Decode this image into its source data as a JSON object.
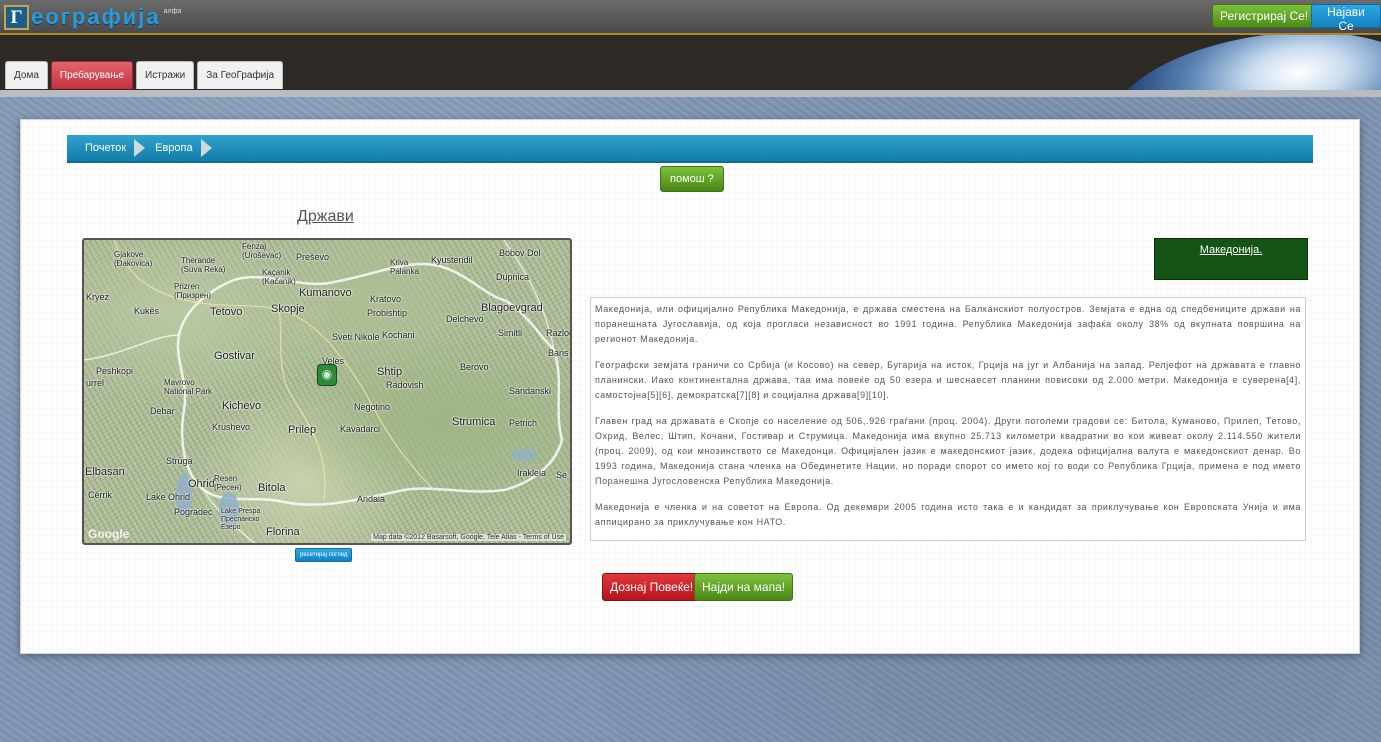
{
  "header": {
    "logo_letter": "Г",
    "logo_text": "еографија",
    "logo_tag": "алфа",
    "register_label": "Регистрирај Се!",
    "login_label": "Најави Се"
  },
  "nav": {
    "tabs": [
      {
        "label": "Дома"
      },
      {
        "label": "Пребарување"
      },
      {
        "label": "Истражи"
      },
      {
        "label": "За ГеоГрафија"
      }
    ]
  },
  "breadcrumb": {
    "items": [
      {
        "label": "Почеток"
      },
      {
        "label": "Европа"
      }
    ]
  },
  "help_label": "помош ?",
  "section_title": "Држави",
  "map": {
    "cities": [
      {
        "name": "Gjakove\n(Đakovica)"
      },
      {
        "name": "Therande\n(Suva Reka)"
      },
      {
        "name": "Fenzaj\n(Uroševac)"
      },
      {
        "name": "Preševo"
      },
      {
        "name": "Kriva\nPalanka"
      },
      {
        "name": "Kyustendil"
      },
      {
        "name": "Bobov Dol"
      },
      {
        "name": "Kaçanik\n(Kačanik)"
      },
      {
        "name": "Prizren\n(Призрен)"
      },
      {
        "name": "Kumanovo"
      },
      {
        "name": "Dupnica"
      },
      {
        "name": "Kryez"
      },
      {
        "name": "Kukës"
      },
      {
        "name": "Tetovo"
      },
      {
        "name": "Skopje"
      },
      {
        "name": "Kratovo"
      },
      {
        "name": "Probishtip"
      },
      {
        "name": "Blagoevgrad"
      },
      {
        "name": "Delchevo"
      },
      {
        "name": "Simitli"
      },
      {
        "name": "Razlog"
      },
      {
        "name": "Sveti Nikole"
      },
      {
        "name": "Kochani"
      },
      {
        "name": "Gostivar"
      },
      {
        "name": "Veles"
      },
      {
        "name": "Bans"
      },
      {
        "name": "Peshkopi"
      },
      {
        "name": "Shtip"
      },
      {
        "name": "Berovo"
      },
      {
        "name": "Mavrovo\nNational Park"
      },
      {
        "name": "Radovish"
      },
      {
        "name": "urrel"
      },
      {
        "name": "Sandanski"
      },
      {
        "name": "Debar"
      },
      {
        "name": "Kichevo"
      },
      {
        "name": "Negotino"
      },
      {
        "name": "Krushevo"
      },
      {
        "name": "Prilep"
      },
      {
        "name": "Kavadarci"
      },
      {
        "name": "Strumica"
      },
      {
        "name": "Petrich"
      },
      {
        "name": "Struga"
      },
      {
        "name": "Elbasan"
      },
      {
        "name": "Ohrid"
      },
      {
        "name": "Resen\n(Ресен)"
      },
      {
        "name": "Bitola"
      },
      {
        "name": "Irakleia"
      },
      {
        "name": "Se"
      },
      {
        "name": "Cërrik"
      },
      {
        "name": "Lake Ohrid"
      },
      {
        "name": "Andaia"
      },
      {
        "name": "Pogradec"
      },
      {
        "name": "Lake Prespa\nПреспанско\nЕзеро"
      },
      {
        "name": "Florina"
      }
    ],
    "attribution": "Map data ©2012 Basarsoft, Google, Tele Atlas - Terms of Use",
    "google_label": "Google",
    "reset_label": "ресетирај поглед"
  },
  "country": {
    "name": "Македонија."
  },
  "description": [
    "Македонија, или официјално Република Македонија, е држава сместена на Балканскиот полуостров. Земјата е една од спедбениците држави на поранешната Југославија, од која прогласи независност во 1991 година. Република Македонија зафаќа околу 38% од вкупната површина на регионот Македонија.",
    "Географски земјата граничи со Србија (и Косово) на север, Бугарија на исток, Грција на југ и Албанија на запад. Релјефот на државата е главно планински. Иако континентална држава, таа има повеќе од 50 езера и шеснаесет планини повисоки од 2.000 метри. Македонија е суверена[4], самостојна[5][6], демократска[7][8] и социјална држава[9][10].",
    "Главен град на државата е Скопје со население од 506,.926 граѓани (проц. 2004). Други поголеми градови се: Битола, Куманово, Прилеп, Тетово, Охрид, Велес, Штип, Кочани, Гостивар и Струмица. Македонија има вкупно 25.713 километри квадратни во кои живеат околу 2.114.550 жители (проц. 2009), од кои мнозинството се Македонци. Официјален јазик е македонскиот јазик, додека официјална валута е македонскиот денар. Во 1993 година, Македонија стана членка на Обединетите Нации, но поради спорот со името кој го води со Република Грција, примена е под името Поранешна Југословенска Република Македонија.",
    "Македонија е членка и на советот на Европа. Од декември 2005 година исто така е и кандидат за приклучување кон Европската Унија и има аппицирано за приклучување кон НАТО."
  ],
  "actions": {
    "more_label": "Дознај Повеќе!",
    "find_label": "Најди на мапа!"
  },
  "colors": {
    "accent_blue": "#1e8fc0",
    "accent_green": "#5a9c22",
    "accent_red": "#c21f25",
    "country_box": "#145414"
  }
}
